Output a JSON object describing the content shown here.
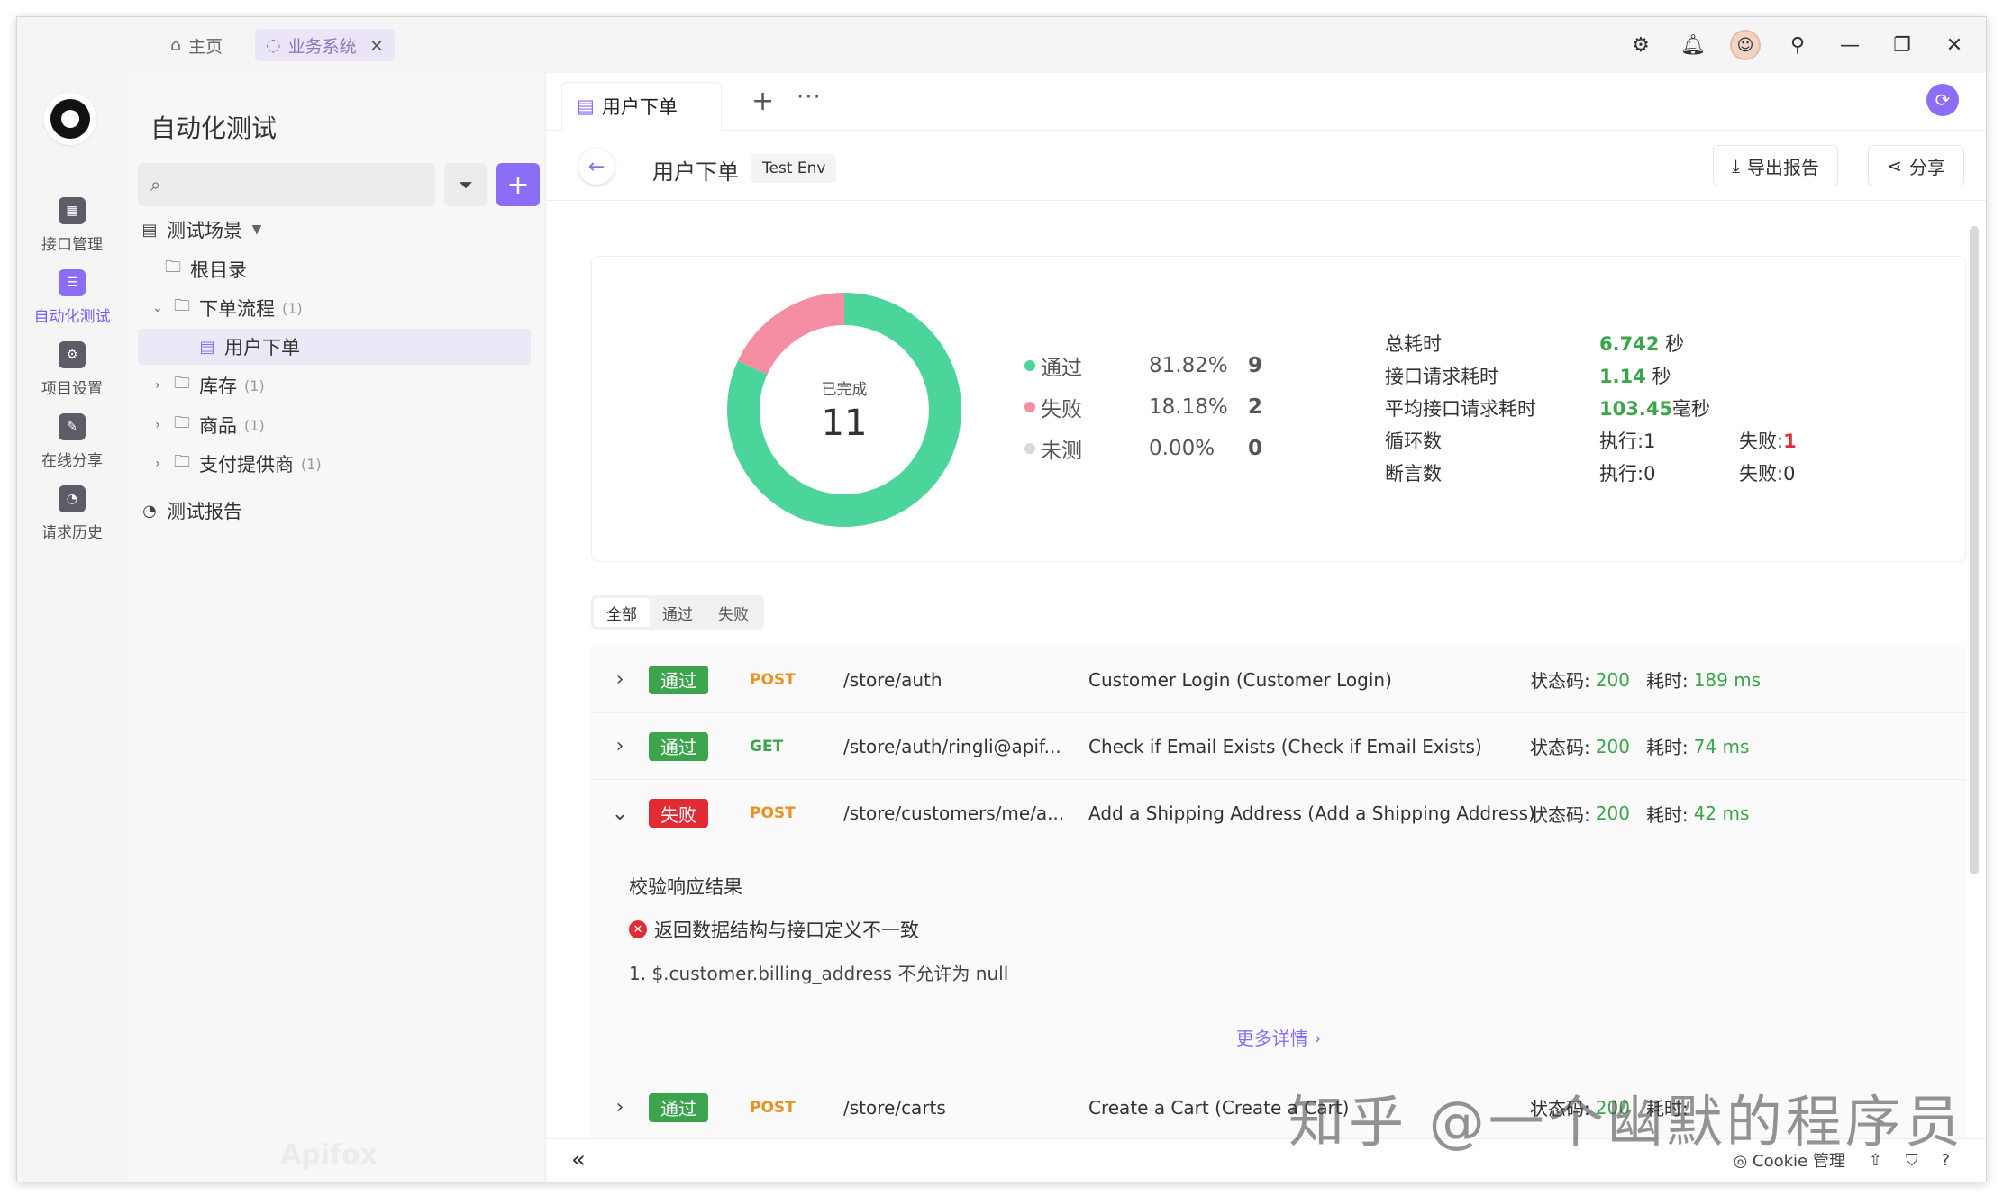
{
  "titlebar": {
    "home_tab": "主页",
    "biz_tab": "业务系统",
    "close_glyph": "×"
  },
  "rail": {
    "items": [
      {
        "label": "接口管理",
        "icon": "api-management-icon"
      },
      {
        "label": "自动化测试",
        "icon": "automation-icon"
      },
      {
        "label": "项目设置",
        "icon": "project-settings-icon"
      },
      {
        "label": "在线分享",
        "icon": "online-share-icon"
      },
      {
        "label": "请求历史",
        "icon": "request-history-icon"
      }
    ]
  },
  "tree": {
    "title": "自动化测试",
    "search_placeholder": "",
    "nodes": [
      {
        "label": "测试场景",
        "count": ""
      },
      {
        "label": "根目录",
        "count": ""
      },
      {
        "label": "下单流程",
        "count": "(1)"
      },
      {
        "label": "用户下单",
        "count": ""
      },
      {
        "label": "库存",
        "count": "(1)"
      },
      {
        "label": "商品",
        "count": "(1)"
      },
      {
        "label": "支付提供商",
        "count": "(1)"
      },
      {
        "label": "测试报告",
        "count": ""
      }
    ],
    "watermark": "Apifox"
  },
  "tabs": {
    "active": "用户下单",
    "plus": "+",
    "more": "···"
  },
  "header": {
    "title": "用户下单",
    "env": "Test Env",
    "export_label": "导出报告",
    "share_label": "分享"
  },
  "summary": {
    "center_label": "已完成",
    "total": "11",
    "legend": [
      {
        "name": "通过",
        "pct": "81.82%",
        "count": "9",
        "color": "#4cd59a"
      },
      {
        "name": "失败",
        "pct": "18.18%",
        "count": "2",
        "color": "#f58ea2"
      },
      {
        "name": "未测",
        "pct": "0.00%",
        "count": "0",
        "color": "#d9d9d9"
      }
    ],
    "stats": {
      "total_time_label": "总耗时",
      "total_time_value": "6.742",
      "total_time_unit": " 秒",
      "req_time_label": "接口请求耗时",
      "req_time_value": "1.14",
      "req_time_unit": " 秒",
      "avg_time_label": "平均接口请求耗时",
      "avg_time_value": "103.45",
      "avg_time_unit": "毫秒",
      "loop_label": "循环数",
      "loop_exec": "执行:1",
      "loop_fail_prefix": "失败:",
      "loop_fail_value": "1",
      "assert_label": "断言数",
      "assert_exec": "执行:0",
      "assert_fail": "失败:0"
    }
  },
  "chart_data": {
    "type": "pie",
    "categories": [
      "通过",
      "失败",
      "未测"
    ],
    "values": [
      9,
      2,
      0
    ],
    "title": ""
  },
  "filters": [
    "全部",
    "通过",
    "失败"
  ],
  "results": [
    {
      "status": "通过",
      "method": "POST",
      "path": "/store/auth",
      "name": "Customer Login (Customer Login)",
      "code_label": "状态码:",
      "code": "200",
      "time_label": "耗时:",
      "time": "189 ms"
    },
    {
      "status": "通过",
      "method": "GET",
      "path": "/store/auth/ringli@apif...",
      "name": "Check if Email Exists (Check if Email Exists)",
      "code_label": "状态码:",
      "code": "200",
      "time_label": "耗时:",
      "time": "74 ms"
    },
    {
      "status": "失败",
      "method": "POST",
      "path": "/store/customers/me/a...",
      "name": "Add a Shipping Address (Add a Shipping Address)",
      "code_label": "状态码:",
      "code": "200",
      "time_label": "耗时:",
      "time": "42 ms"
    },
    {
      "status": "通过",
      "method": "POST",
      "path": "/store/carts",
      "name": "Create a Cart (Create a Cart)",
      "code_label": "状态码:",
      "code": "200",
      "time_label": "耗时:",
      "time": ""
    }
  ],
  "detail": {
    "heading": "校验响应结果",
    "error": "返回数据结构与接口定义不一致",
    "item": "1. $.customer.billing_address 不允许为 null",
    "more": "更多详情 ›"
  },
  "statusbar": {
    "cookie": "Cookie 管理"
  },
  "watermark": "知乎 @一个幽默的程序员"
}
